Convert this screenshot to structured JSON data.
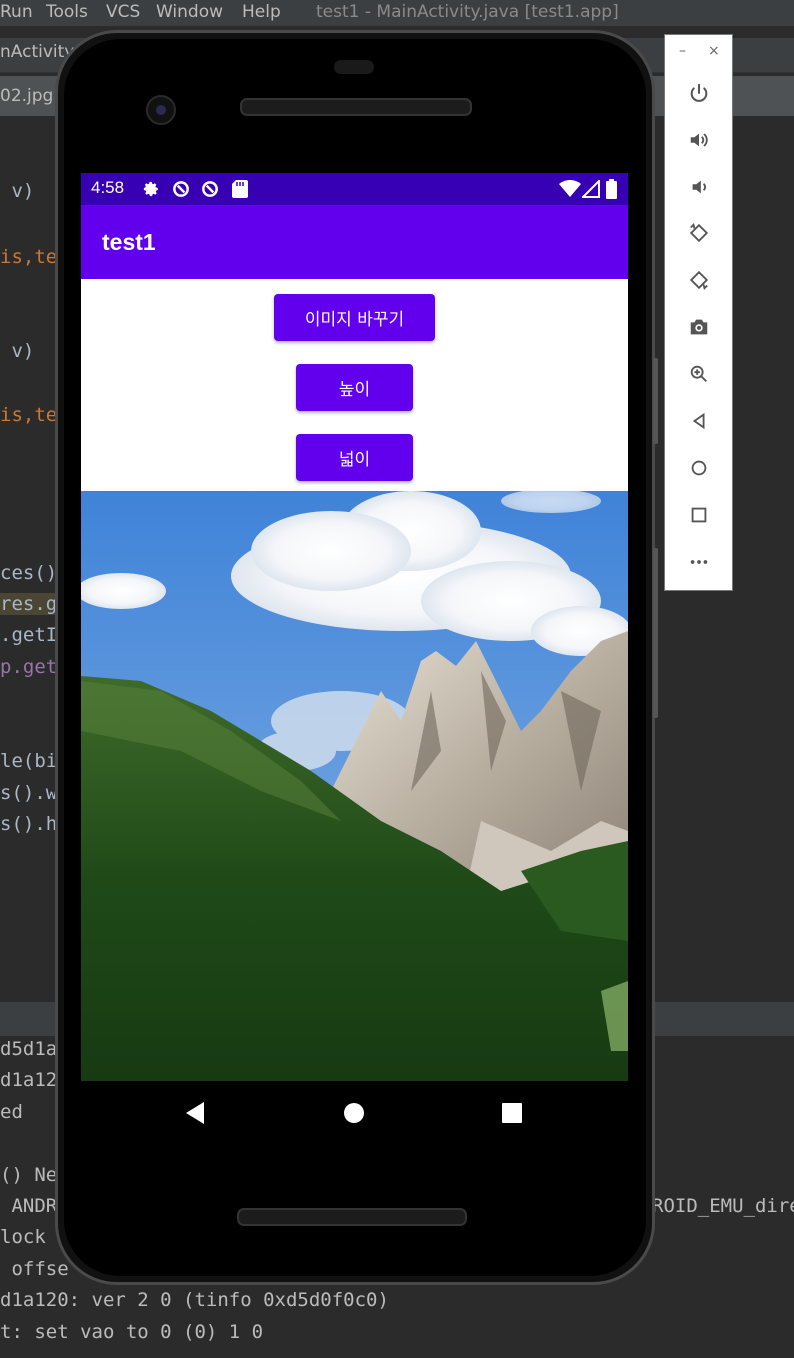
{
  "ide": {
    "menu": [
      "Run",
      "Tools",
      "VCS",
      "Window",
      "Help"
    ],
    "window_title": "test1 - MainActivity.java [test1.app]",
    "editor_tab": "nActivity",
    "file_tab": "02.jpg",
    "code_lines": [
      {
        "text": " v)",
        "tone": "plain"
      },
      {
        "text": "is,te",
        "tone": "orange"
      },
      {
        "text": " v)",
        "tone": "plain"
      },
      {
        "text": "is,te",
        "tone": "orange"
      },
      {
        "text": "ces()",
        "tone": "plain"
      },
      {
        "text": "res.g",
        "tone": "plain"
      },
      {
        "text": ".getI",
        "tone": "plain"
      },
      {
        "text": "p.get",
        "tone": "plain"
      },
      {
        "text": "le(bi",
        "tone": "plain"
      },
      {
        "text": "s().w",
        "tone": "plain"
      },
      {
        "text": "s().h",
        "tone": "plain"
      }
    ],
    "console_lines": [
      "d5d1a",
      "d1a12",
      "ed",
      "() Ne",
      " ANDR",
      "lock ",
      " offse",
      "d1a120: ver 2 0 (tinfo 0xd5d0f0c0)",
      "t: set vao to 0 (0) 1 0"
    ],
    "console_right": "ROID_EMU_dire"
  },
  "emulator": {
    "minimize": "–",
    "close": "×",
    "tools": [
      "power-icon",
      "volume-up-icon",
      "volume-down-icon",
      "rotate-left-icon",
      "rotate-right-icon",
      "camera-icon",
      "zoom-icon",
      "back-icon",
      "home-icon",
      "overview-icon",
      "more-icon"
    ]
  },
  "device": {
    "status": {
      "time": "4:58"
    },
    "app_title": "test1",
    "buttons": {
      "change_image": "이미지 바꾸기",
      "height": "높이",
      "width": "넓이"
    },
    "colors": {
      "primary": "#6200ee",
      "primary_dark": "#3700b3"
    }
  }
}
